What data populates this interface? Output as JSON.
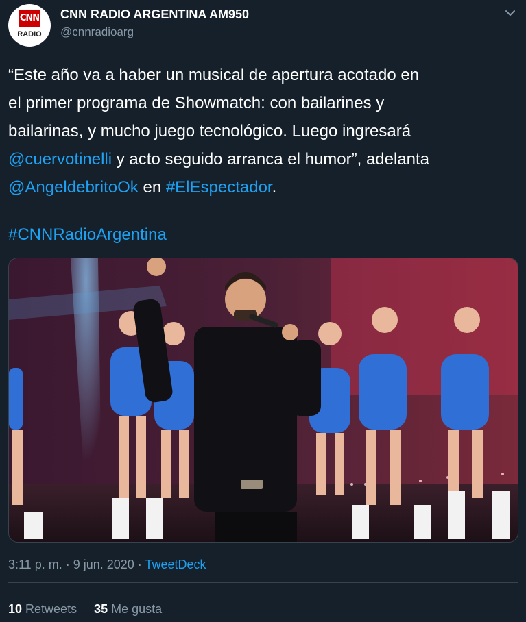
{
  "account": {
    "name": "CNN RADIO ARGENTINA AM950",
    "handle": "@cnnradioarg",
    "avatar_logo": "CNN",
    "avatar_sublabel": "RADIO"
  },
  "tweet": {
    "line1": "“Este año va a haber un musical de apertura acotado en",
    "line2": "el primer programa de Showmatch: con bailarines y",
    "line3": "bailarinas, y mucho juego tecnológico. Luego ingresará",
    "mention1": "@cuervotinelli",
    "line4_rest": " y acto seguido arranca el humor”, adelanta",
    "mention2": "@AngeldebritoOk",
    "line5_mid": " en ",
    "hashtag1": "#ElEspectador",
    "line5_end": ".",
    "hashtag2": "#CNNRadioArgentina"
  },
  "media": {
    "description_icon": "photo-tv-show-stage"
  },
  "meta": {
    "timestamp": "3:11 p. m. · 9 jun. 2020 · ",
    "source": "TweetDeck"
  },
  "stats": {
    "retweets_count": "10",
    "retweets_label": " Retweets",
    "likes_count": "35",
    "likes_label": " Me gusta"
  },
  "colors": {
    "background": "#15202b",
    "link": "#1da1f2",
    "secondary_text": "#8899a6",
    "divider": "#38444d"
  }
}
